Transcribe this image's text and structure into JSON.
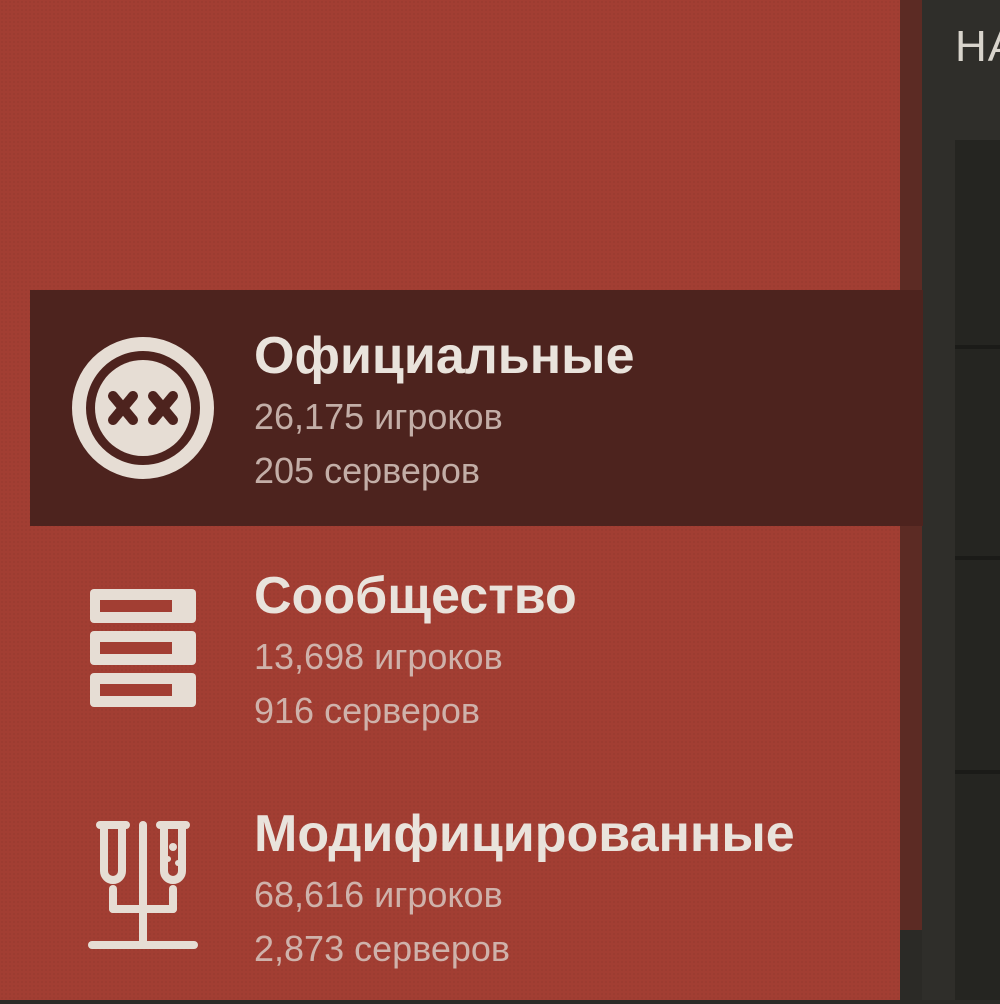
{
  "header": {
    "title_partial": "НА"
  },
  "categories": [
    {
      "name": "Официальные",
      "players": "26,175 игроков",
      "servers": "205 серверов",
      "icon": "official-rust-icon",
      "selected": true
    },
    {
      "name": "Сообщество",
      "players": "13,698 игроков",
      "servers": "916 серверов",
      "icon": "server-stack-icon",
      "selected": false
    },
    {
      "name": "Модифицированные",
      "players": "68,616 игроков",
      "servers": "2,873 серверов",
      "icon": "test-tubes-icon",
      "selected": false
    }
  ],
  "colors": {
    "panel": "#a23e33",
    "selected": "#4d231e",
    "text": "#e9e3dc",
    "icon": "#e6ddd4",
    "background": "#2b2a26"
  }
}
